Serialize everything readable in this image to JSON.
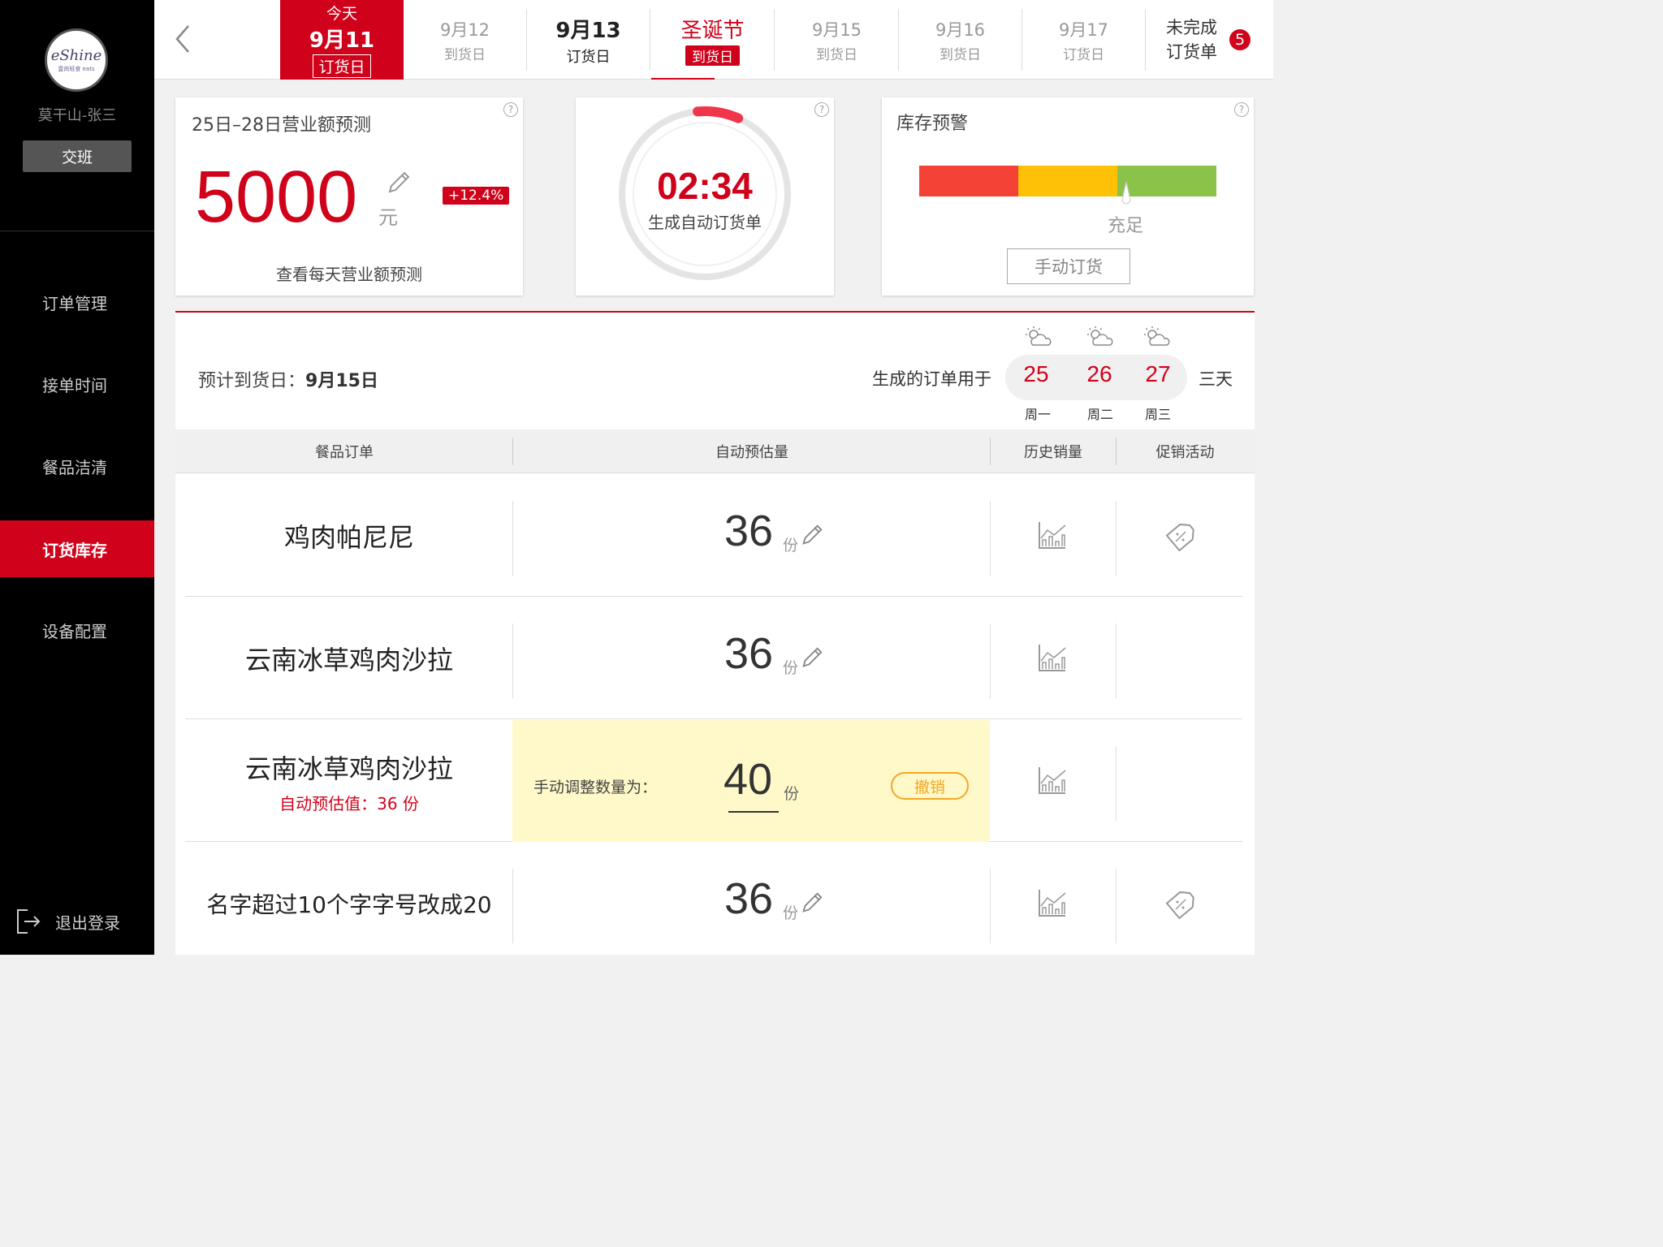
{
  "sidebar": {
    "logo_text": "eShine",
    "logo_sub": "壹尚轻食 eats",
    "store_user": "莫干山-张三",
    "shift_button": "交班",
    "nav": [
      {
        "label": "订单管理"
      },
      {
        "label": "接单时间"
      },
      {
        "label": "餐品洁清"
      },
      {
        "label": "订货库存",
        "active": true
      },
      {
        "label": "设备配置"
      }
    ],
    "logout": "退出登录"
  },
  "datebar": {
    "today": {
      "top": "今天",
      "date": "9月11",
      "tag": "订货日"
    },
    "dates": [
      {
        "date": "9月12",
        "tag": "到货日"
      },
      {
        "date": "9月13",
        "tag": "订货日"
      },
      {
        "date": "圣诞节",
        "tag": "到货日"
      },
      {
        "date": "9月15",
        "tag": "到货日"
      },
      {
        "date": "9月16",
        "tag": "到货日"
      },
      {
        "date": "9月17",
        "tag": "订货日"
      }
    ],
    "pending_line1": "未完成",
    "pending_line2": "订货单",
    "pending_count": "5"
  },
  "forecast": {
    "title": "25日–28日营业额预测",
    "value": "5000",
    "unit": "元",
    "change": "+12.4%",
    "link": "查看每天营业额预测"
  },
  "timer": {
    "time": "02:34",
    "label": "生成自动订货单",
    "progress": 0.08
  },
  "stock": {
    "title": "库存预警",
    "status": "充足",
    "manual_button": "手动订货",
    "colors": [
      "#f44336",
      "#ffc107",
      "#8bc34a"
    ]
  },
  "order": {
    "arrival_label": "预计到货日：",
    "arrival_date": "9月15日",
    "use_for": "生成的订单用于",
    "days": [
      {
        "num": "25",
        "week": "周一"
      },
      {
        "num": "26",
        "week": "周二"
      },
      {
        "num": "27",
        "week": "周三"
      }
    ],
    "three_days": "三天",
    "headers": [
      "餐品订单",
      "自动预估量",
      "历史销量",
      "促销活动"
    ],
    "rows": [
      {
        "name": "鸡肉帕尼尼",
        "qty": "36",
        "unit": "份"
      },
      {
        "name": "云南冰草鸡肉沙拉",
        "qty": "36",
        "unit": "份"
      },
      {
        "name": "云南冰草鸡肉沙拉",
        "sub": "自动预估值：36 份",
        "manual_label": "手动调整数量为：",
        "manual_qty": "40",
        "unit": "份",
        "undo": "撤销"
      },
      {
        "name": "名字超过10个字字号改成20",
        "qty": "36",
        "unit": "份"
      }
    ]
  }
}
